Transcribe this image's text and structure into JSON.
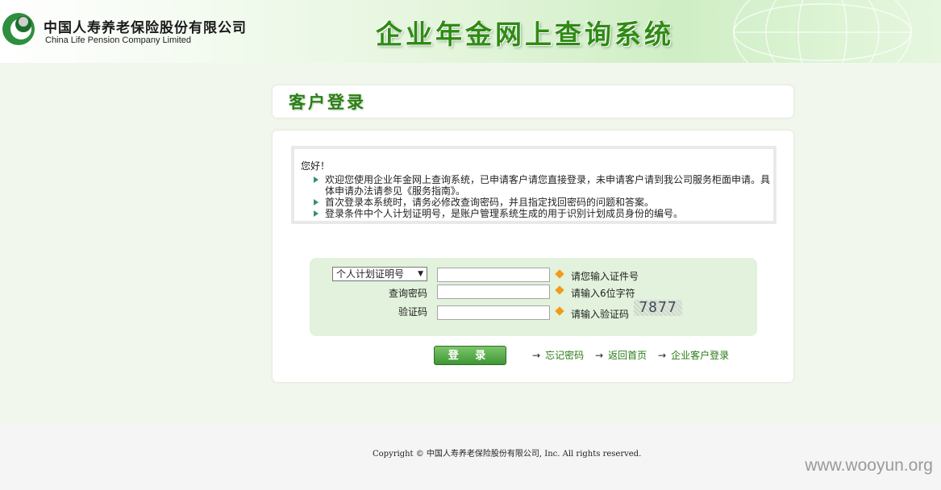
{
  "header": {
    "company_cn": "中国人寿养老保险股份有限公司",
    "company_en": "China Life Pension Company Limited",
    "system_title": "企业年金网上查询系统",
    "logo_icon": "china-life-logo",
    "brand_color": "#2f8b14"
  },
  "panel": {
    "title": "客户登录",
    "notice": {
      "greeting": "您好！",
      "items": [
        "欢迎您使用企业年金网上查询系统，已申请客户请您直接登录，未申请客户请到我公司服务柜面申请。具体申请办法请参见《服务指南》。",
        "首次登录本系统时，请务必修改查询密码，并且指定找回密码的问题和答案。",
        "登录条件中个人计划证明号，是账户管理系统生成的用于识别计划成员身份的编号。"
      ]
    },
    "form": {
      "id_type_selected": "个人计划证明号",
      "password_label": "查询密码",
      "captcha_label": "验证码",
      "id_hint": "请您输入证件号",
      "password_hint": "请输入6位字符",
      "captcha_hint": "请输入验证码",
      "captcha_text": "7877",
      "id_value": "",
      "password_value": "",
      "captcha_value": ""
    },
    "login_button": "登 录",
    "links": {
      "forgot": "忘记密码",
      "home": "返回首页",
      "enterprise": "企业客户登录"
    }
  },
  "footer": {
    "copyright": "Copyright © 中国人寿养老保险股份有限公司, Inc. All rights reserved.",
    "watermark": "www.wooyun.org"
  }
}
